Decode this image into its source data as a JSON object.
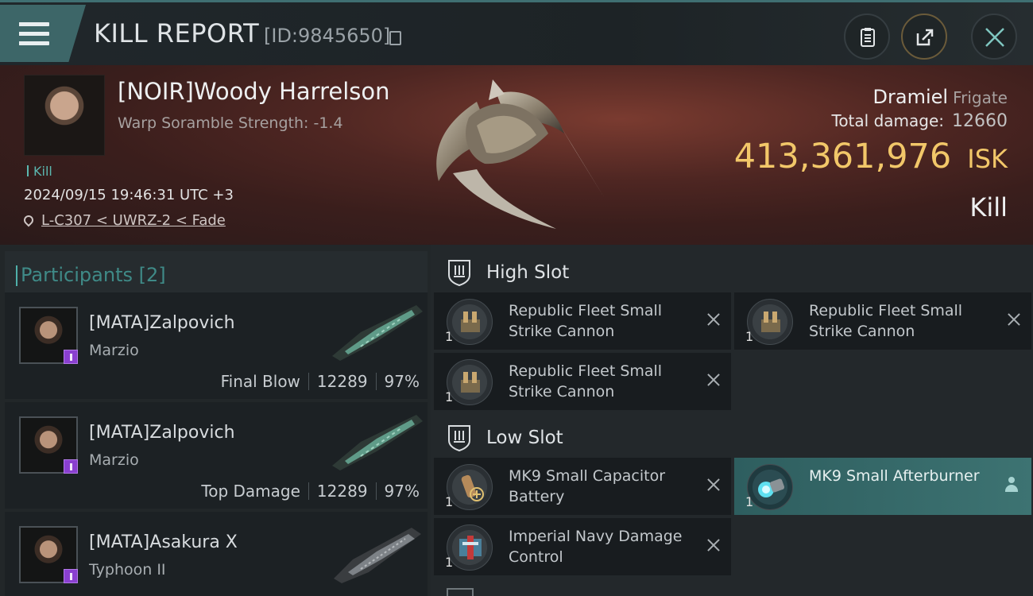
{
  "header": {
    "title": "KILL REPORT",
    "report_id": "[ID:9845650]",
    "icons": [
      "menu-icon",
      "copy-icon",
      "clipboard-icon",
      "share-icon",
      "close-icon"
    ]
  },
  "victim": {
    "name": "[NOIR]Woody Harrelson",
    "scramble_label": "Warp Soramble Strength: -1.4",
    "kill_tag": "Kill",
    "timestamp": "2024/09/15 19:46:31 UTC +3",
    "location": "L-C307 < UWRZ-2 < Fade",
    "ship_name": "Dramiel",
    "ship_class": "Frigate",
    "total_damage_label": "Total damage:",
    "total_damage": "12660",
    "isk_value": "413,361,976",
    "isk_unit": "ISK",
    "result": "Kill"
  },
  "participants": {
    "header": "Participants [2]",
    "rows": [
      {
        "name": "[MATA]Zalpovich",
        "ship": "Marzio",
        "role": "Final Blow",
        "damage": "12289",
        "percent": "97%"
      },
      {
        "name": "[MATA]Zalpovich",
        "ship": "Marzio",
        "role": "Top Damage",
        "damage": "12289",
        "percent": "97%"
      },
      {
        "name": "[MATA]Asakura X",
        "ship": "Typhoon II"
      }
    ]
  },
  "high_slot": {
    "label": "High Slot",
    "modules": [
      {
        "name": "Republic Fleet Small Strike Cannon",
        "qty": "1"
      },
      {
        "name": "Republic Fleet Small Strike Cannon",
        "qty": "1"
      },
      {
        "name": "Republic Fleet Small Strike Cannon",
        "qty": "1"
      }
    ]
  },
  "low_slot": {
    "label": "Low Slot",
    "modules": [
      {
        "name": "MK9 Small Capacitor Battery",
        "qty": "1"
      },
      {
        "name": "MK9 Small Afterburner",
        "qty": "1"
      },
      {
        "name": "Imperial Navy Damage Control",
        "qty": "1"
      }
    ]
  },
  "colors": {
    "accent_teal": "#3d6668",
    "isk_gold": "#f2c769",
    "badge_purple": "#8a3fd0",
    "highlight_row": "#3d7372"
  }
}
